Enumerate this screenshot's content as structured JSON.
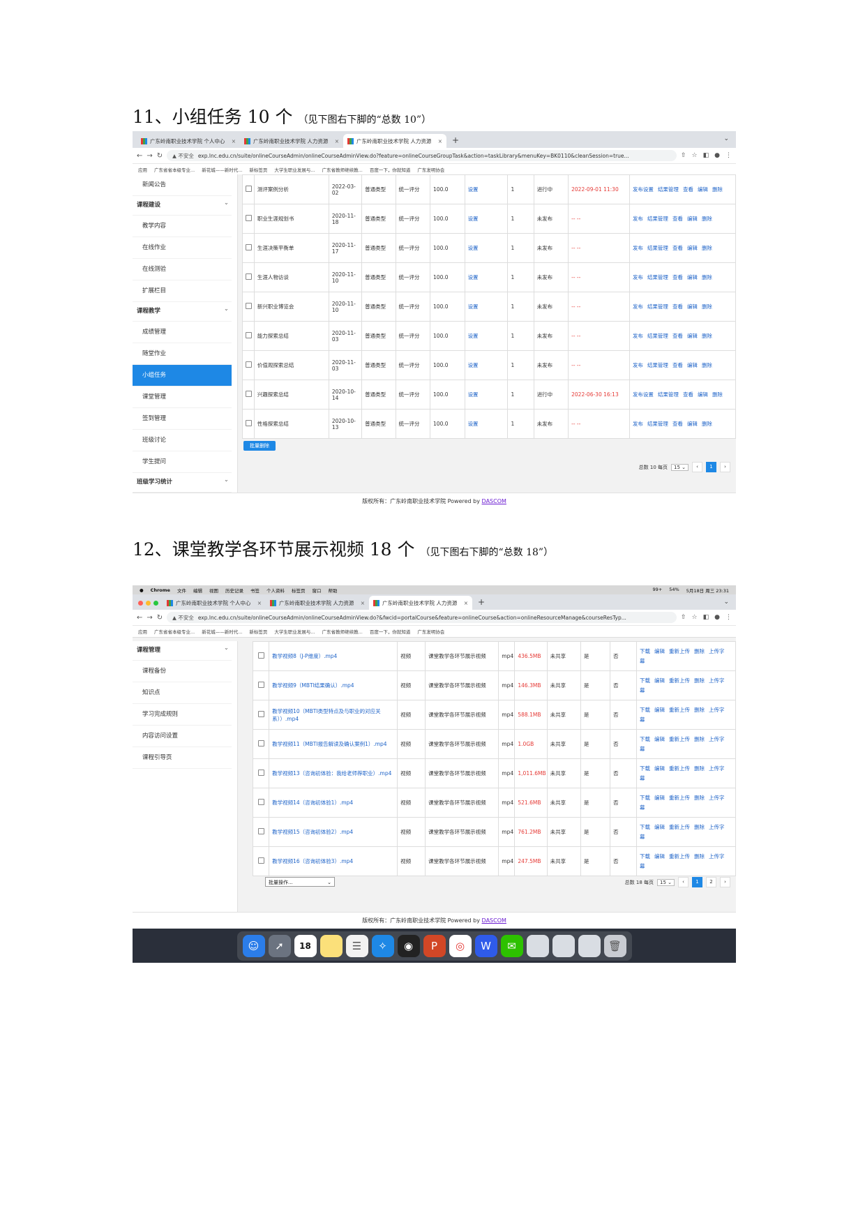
{
  "section11": {
    "heading": "11、小组任务 10 个",
    "note": "（见下图右下脚的“总数 10”）"
  },
  "section12": {
    "heading": "12、课堂教学各环节展示视频 18 个",
    "note": "（见下图右下脚的“总数 18”）"
  },
  "shot1": {
    "tabs": [
      "广东岭南职业技术学院 个人中心",
      "广东岭南职业技术学院 人力资源",
      "广东岭南职业技术学院 人力资源"
    ],
    "new_tab": "+",
    "tab_close": "×",
    "url_warning": "▲ 不安全",
    "url": "exp.lnc.edu.cn/suite/onlineCourseAdmin/onlineCourseAdminView.do?feature=onlineCourseGroupTask&action=taskLibrary&menuKey=BK0110&cleanSession=true...",
    "bookmarks": [
      "应用",
      "广东省省本级专业...",
      "新花城——新时代...",
      "新标签页",
      "大学生职业发展与...",
      "广东省教师继续教...",
      "百度一下，你就知道",
      "广东发明协会"
    ],
    "sidebar": [
      {
        "label": "新闻公告",
        "type": "item"
      },
      {
        "label": "课程建设",
        "type": "group"
      },
      {
        "label": "教学内容",
        "type": "item"
      },
      {
        "label": "在线作业",
        "type": "item"
      },
      {
        "label": "在线测验",
        "type": "item"
      },
      {
        "label": "扩展栏目",
        "type": "item"
      },
      {
        "label": "课程教学",
        "type": "group"
      },
      {
        "label": "成绩管理",
        "type": "item"
      },
      {
        "label": "随堂作业",
        "type": "item"
      },
      {
        "label": "小组任务",
        "type": "active"
      },
      {
        "label": "课堂管理",
        "type": "item"
      },
      {
        "label": "签到管理",
        "type": "item"
      },
      {
        "label": "班级讨论",
        "type": "item"
      },
      {
        "label": "学生提问",
        "type": "item"
      },
      {
        "label": "班级学习统计",
        "type": "group"
      }
    ],
    "rows": [
      {
        "name": "测评案例分析",
        "date": "2022-03-02",
        "type": "普通类型",
        "score_mode": "统一评分",
        "score": "100.0",
        "setting": "设置",
        "count": "1",
        "status": "进行中",
        "deadline": "2022-09-01 11:30",
        "ops": [
          "发布设置",
          "结果管理",
          "查看",
          "编辑",
          "删除"
        ]
      },
      {
        "name": "职业生涯规划书",
        "date": "2020-11-18",
        "type": "普通类型",
        "score_mode": "统一评分",
        "score": "100.0",
        "setting": "设置",
        "count": "1",
        "status": "未发布",
        "deadline": "-- --",
        "ops": [
          "发布",
          "结果管理",
          "查看",
          "编辑",
          "删除"
        ]
      },
      {
        "name": "生涯决策平衡单",
        "date": "2020-11-17",
        "type": "普通类型",
        "score_mode": "统一评分",
        "score": "100.0",
        "setting": "设置",
        "count": "1",
        "status": "未发布",
        "deadline": "-- --",
        "ops": [
          "发布",
          "结果管理",
          "查看",
          "编辑",
          "删除"
        ]
      },
      {
        "name": "生涯人物访谈",
        "date": "2020-11-10",
        "type": "普通类型",
        "score_mode": "统一评分",
        "score": "100.0",
        "setting": "设置",
        "count": "1",
        "status": "未发布",
        "deadline": "-- --",
        "ops": [
          "发布",
          "结果管理",
          "查看",
          "编辑",
          "删除"
        ]
      },
      {
        "name": "新兴职业博览会",
        "date": "2020-11-10",
        "type": "普通类型",
        "score_mode": "统一评分",
        "score": "100.0",
        "setting": "设置",
        "count": "1",
        "status": "未发布",
        "deadline": "-- --",
        "ops": [
          "发布",
          "结果管理",
          "查看",
          "编辑",
          "删除"
        ]
      },
      {
        "name": "能力探索总结",
        "date": "2020-11-03",
        "type": "普通类型",
        "score_mode": "统一评分",
        "score": "100.0",
        "setting": "设置",
        "count": "1",
        "status": "未发布",
        "deadline": "-- --",
        "ops": [
          "发布",
          "结果管理",
          "查看",
          "编辑",
          "删除"
        ]
      },
      {
        "name": "价值观探索总结",
        "date": "2020-11-03",
        "type": "普通类型",
        "score_mode": "统一评分",
        "score": "100.0",
        "setting": "设置",
        "count": "1",
        "status": "未发布",
        "deadline": "-- --",
        "ops": [
          "发布",
          "结果管理",
          "查看",
          "编辑",
          "删除"
        ]
      },
      {
        "name": "兴趣探索总结",
        "date": "2020-10-14",
        "type": "普通类型",
        "score_mode": "统一评分",
        "score": "100.0",
        "setting": "设置",
        "count": "1",
        "status": "进行中",
        "deadline": "2022-06-30 16:13",
        "ops": [
          "发布设置",
          "结果管理",
          "查看",
          "编辑",
          "删除"
        ]
      },
      {
        "name": "性格探索总结",
        "date": "2020-10-13",
        "type": "普通类型",
        "score_mode": "统一评分",
        "score": "100.0",
        "setting": "设置",
        "count": "1",
        "status": "未发布",
        "deadline": "-- --",
        "ops": [
          "发布",
          "结果管理",
          "查看",
          "编辑",
          "删除"
        ]
      }
    ],
    "batch_delete": "批量删除",
    "pager": {
      "total": "总数 10 每页",
      "per_page": "15 ⌄",
      "prev": "‹",
      "page": "1",
      "next": "›"
    },
    "footer_prefix": "版权所有：广东岭南职业技术学院 Powered by",
    "footer_link": "DASCOM"
  },
  "shot2": {
    "menubar": [
      "",
      "Chrome",
      "文件",
      "编辑",
      "视图",
      "历史记录",
      "书签",
      "个人资料",
      "标签页",
      "窗口",
      "帮助"
    ],
    "menubar_right": [
      "99+",
      "54%",
      "5月18日 周三 23:31"
    ],
    "tabs": [
      "广东岭南职业技术学院 个人中心",
      "广东岭南职业技术学院 人力资源",
      "广东岭南职业技术学院 人力资源"
    ],
    "new_tab": "+",
    "tab_close": "×",
    "url_warning": "▲ 不安全",
    "url": "exp.lnc.edu.cn/suite/onlineCourseAdmin/onlineCourseAdminView.do?&fwcid=portalCourse&feature=onlineCourse&action=onlineResourceManage&courseResTyp...",
    "bookmarks": [
      "应用",
      "广东省省本级专业...",
      "新花城——新时代...",
      "新标签页",
      "大学生职业发展与...",
      "广东省教师继续教...",
      "百度一下，你就知道",
      "广东发明协会"
    ],
    "sidebar": [
      {
        "label": "课程管理",
        "type": "group"
      },
      {
        "label": "课程备份",
        "type": "item"
      },
      {
        "label": "知识点",
        "type": "item"
      },
      {
        "label": "学习完成规则",
        "type": "item"
      },
      {
        "label": "内容访问设置",
        "type": "item"
      },
      {
        "label": "课程引导页",
        "type": "item"
      }
    ],
    "rows": [
      {
        "name": "教学视频8（J-P维度）.mp4",
        "kind": "视频",
        "category": "课堂教学各环节展示视频",
        "ext": "mp4",
        "size": "436.5MB",
        "share": "未共享",
        "col7": "是",
        "col8": "否",
        "ops": [
          "下载",
          "编辑",
          "重新上传",
          "删除",
          "上传字幕"
        ]
      },
      {
        "name": "教学视频9（MBTI结果确认）.mp4",
        "kind": "视频",
        "category": "课堂教学各环节展示视频",
        "ext": "mp4",
        "size": "146.3MB",
        "share": "未共享",
        "col7": "是",
        "col8": "否",
        "ops": [
          "下载",
          "编辑",
          "重新上传",
          "删除",
          "上传字幕"
        ]
      },
      {
        "name": "教学视频10（MBTI类型特点及与职业的对应关系））.mp4",
        "kind": "视频",
        "category": "课堂教学各环节展示视频",
        "ext": "mp4",
        "size": "588.1MB",
        "share": "未共享",
        "col7": "是",
        "col8": "否",
        "ops": [
          "下载",
          "编辑",
          "重新上传",
          "删除",
          "上传字幕"
        ]
      },
      {
        "name": "教学视频11（MBTI报告解读及确认案例1）.mp4",
        "kind": "视频",
        "category": "课堂教学各环节展示视频",
        "ext": "mp4",
        "size": "1.0GB",
        "share": "未共享",
        "col7": "是",
        "col8": "否",
        "ops": [
          "下载",
          "编辑",
          "重新上传",
          "删除",
          "上传字幕"
        ]
      },
      {
        "name": "教学视频13（咨询初体验：我给老师荐职业）.mp4",
        "kind": "视频",
        "category": "课堂教学各环节展示视频",
        "ext": "mp4",
        "size": "1,011.6MB",
        "share": "未共享",
        "col7": "是",
        "col8": "否",
        "ops": [
          "下载",
          "编辑",
          "重新上传",
          "删除",
          "上传字幕"
        ]
      },
      {
        "name": "教学视频14（咨询初体验1）.mp4",
        "kind": "视频",
        "category": "课堂教学各环节展示视频",
        "ext": "mp4",
        "size": "521.6MB",
        "share": "未共享",
        "col7": "是",
        "col8": "否",
        "ops": [
          "下载",
          "编辑",
          "重新上传",
          "删除",
          "上传字幕"
        ]
      },
      {
        "name": "教学视频15（咨询初体验2）.mp4",
        "kind": "视频",
        "category": "课堂教学各环节展示视频",
        "ext": "mp4",
        "size": "761.2MB",
        "share": "未共享",
        "col7": "是",
        "col8": "否",
        "ops": [
          "下载",
          "编辑",
          "重新上传",
          "删除",
          "上传字幕"
        ]
      },
      {
        "name": "教学视频16（咨询初体验3）.mp4",
        "kind": "视频",
        "category": "课堂教学各环节展示视频",
        "ext": "mp4",
        "size": "247.5MB",
        "share": "未共享",
        "col7": "是",
        "col8": "否",
        "ops": [
          "下载",
          "编辑",
          "重新上传",
          "删除",
          "上传字幕"
        ]
      }
    ],
    "batch_select": "批量操作...",
    "pager": {
      "total": "总数 18 每页",
      "per_page": "15 ⌄",
      "prev": "‹",
      "page1": "1",
      "page2": "2",
      "next": "›"
    },
    "footer_prefix": "版权所有：广东岭南职业技术学院 Powered by",
    "footer_link": "DASCOM",
    "dock_calendar": "18"
  },
  "colors": {
    "accent": "#1e88e5",
    "link": "#1e63c8",
    "danger": "#e53935"
  }
}
